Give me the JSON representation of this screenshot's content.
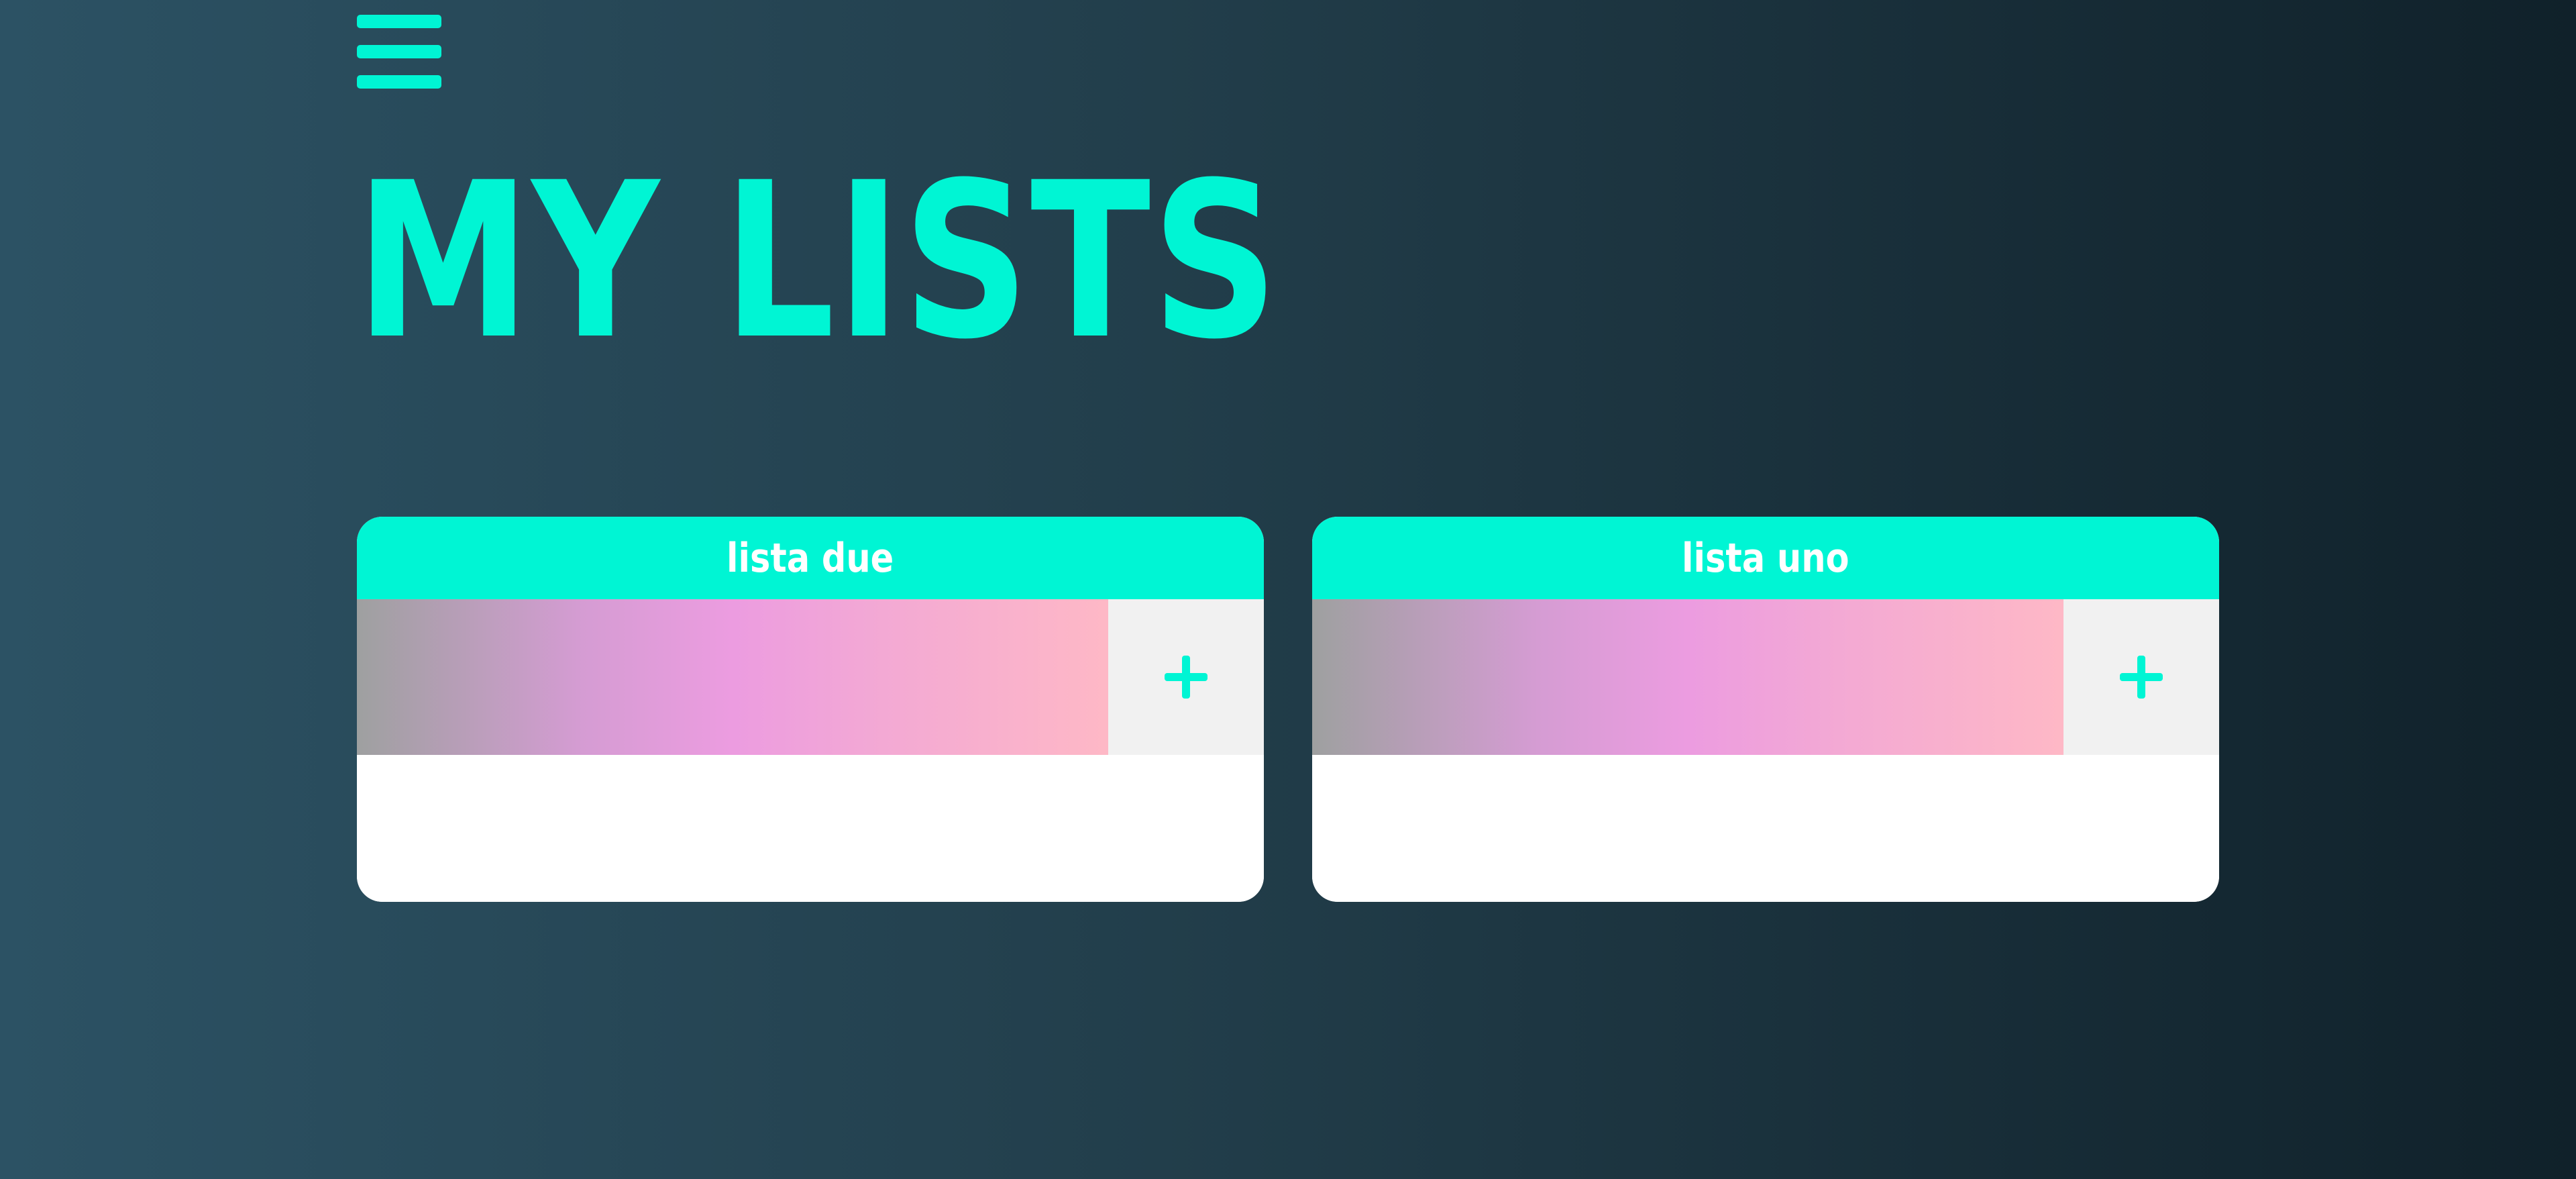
{
  "header": {
    "menu_icon": "hamburger-icon",
    "title": "MY LISTS"
  },
  "theme": {
    "accent": "#00f5d4",
    "card_background": "#ffffff",
    "button_background": "#f1f1f1"
  },
  "lists": [
    {
      "title": "lista due",
      "input_value": "",
      "add_icon": "plus-icon",
      "items": []
    },
    {
      "title": "lista uno",
      "input_value": "",
      "add_icon": "plus-icon",
      "items": []
    }
  ]
}
